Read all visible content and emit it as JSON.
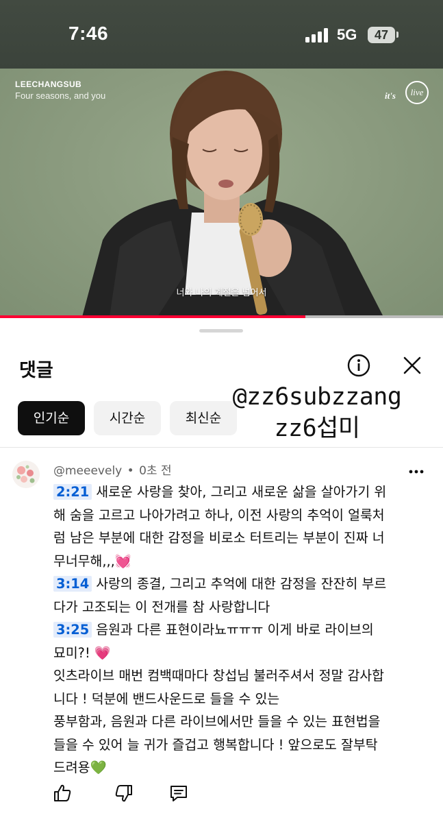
{
  "status_bar": {
    "time": "7:46",
    "network": "5G",
    "battery": "47"
  },
  "video": {
    "title": "LEECHANGSUB",
    "subtitle": "Four seasons, and you",
    "logo_text_1": "it's",
    "logo_text_2": "live",
    "caption": "너와 나의 계절을 넘어서",
    "progress_fraction": 0.69,
    "progress_color": "#ff0033"
  },
  "comments_panel": {
    "title": "댓글",
    "info_icon": "info-icon",
    "close_icon": "close-icon",
    "sort_chips": [
      {
        "label": "인기순",
        "active": true
      },
      {
        "label": "시간순",
        "active": false
      },
      {
        "label": "최신순",
        "active": false
      }
    ],
    "watermark": {
      "line1": "@zz6subzzang",
      "line2": "zz6섭미"
    }
  },
  "comment": {
    "author": "@meeevely",
    "separator": "•",
    "time": "0초 전",
    "timestamps": [
      "2:21",
      "3:14",
      "3:25"
    ],
    "lines": [
      "새로운 사랑을 찾아, 그리고 새로운 삶을 살아가기 위",
      "해 숨을 고르고 나아가려고 하나, 이전 사랑의 추억이 얼룩처",
      "럼 남은 부분에 대한 감정을 비로소 터트리는 부분이 진짜 너",
      "무너무해,,,",
      "사랑의 종결, 그리고 추억에 대한 감정을 잔잔히 부르",
      "다가 고조되는 이 전개를 참 사랑합니다",
      "음원과 다른 표현이라뇨ㅠㅠㅠ 이게 바로 라이브의",
      "묘미?!",
      "잇츠라이브 매번 컴백때마다 창섭님 불러주셔서 정말 감사합",
      "니다 ! 덕분에 밴드사운드로 들을 수 있는",
      "풍부함과, 음원과 다른 라이브에서만 들을 수 있는 표현법을",
      "들을 수 있어 늘 귀가 즐겁고 행복합니다 ! 앞으로도 잘부탁",
      "드려용"
    ],
    "emoji": {
      "heart_pink": "💓",
      "heart_pink_2": "💗",
      "heart_green": "💚"
    },
    "action_icons": [
      "thumbs-up-icon",
      "thumbs-down-icon",
      "reply-icon"
    ]
  }
}
